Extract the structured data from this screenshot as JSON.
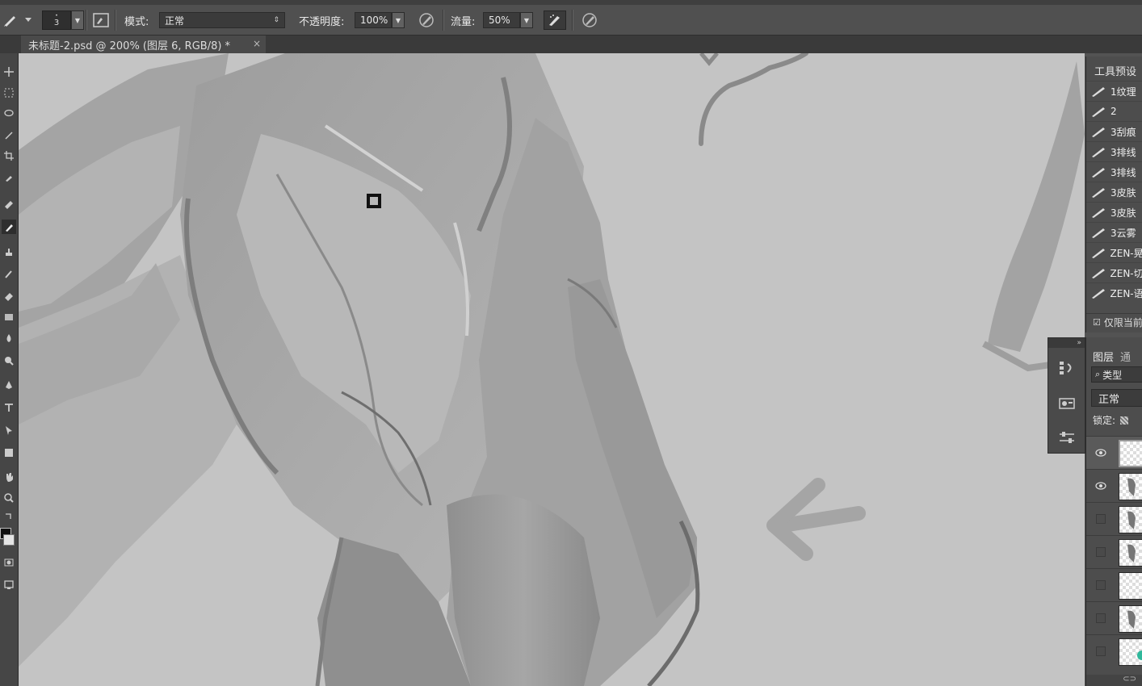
{
  "options_bar": {
    "brush_size": "3",
    "mode_label": "模式:",
    "mode_value": "正常",
    "opacity_label": "不透明度:",
    "opacity_value": "100%",
    "flow_label": "流量:",
    "flow_value": "50%"
  },
  "document_tab": {
    "title": "未标题-2.psd @ 200% (图层 6, RGB/8) *",
    "close": "×"
  },
  "tool_presets": {
    "header": "工具预设",
    "items": [
      "1纹理",
      "2",
      "3刮痕",
      "3排线",
      "3排线",
      "3皮肤",
      "3皮肤",
      "3云雾",
      "ZEN-晃",
      "ZEN-切",
      "ZEN-语"
    ],
    "footer_checkbox_label": "仅限当前"
  },
  "layers_panel": {
    "tab_layers": "图层",
    "tab_channels": "通",
    "filter_label": "类型",
    "blend_mode": "正常",
    "lock_label": "锁定:",
    "rows": [
      {
        "visible": true,
        "selected": true,
        "content": "empty"
      },
      {
        "visible": true,
        "selected": false,
        "content": "figure"
      },
      {
        "visible": false,
        "selected": false,
        "content": "figure"
      },
      {
        "visible": false,
        "selected": false,
        "content": "figure"
      },
      {
        "visible": false,
        "selected": false,
        "content": "empty"
      },
      {
        "visible": false,
        "selected": false,
        "content": "figure"
      },
      {
        "visible": false,
        "selected": false,
        "content": "empty"
      }
    ]
  },
  "colors": {
    "ui_dark": "#535353",
    "canvas_bg": "#c4c4c4",
    "teal_accent": "#2fb89b"
  }
}
